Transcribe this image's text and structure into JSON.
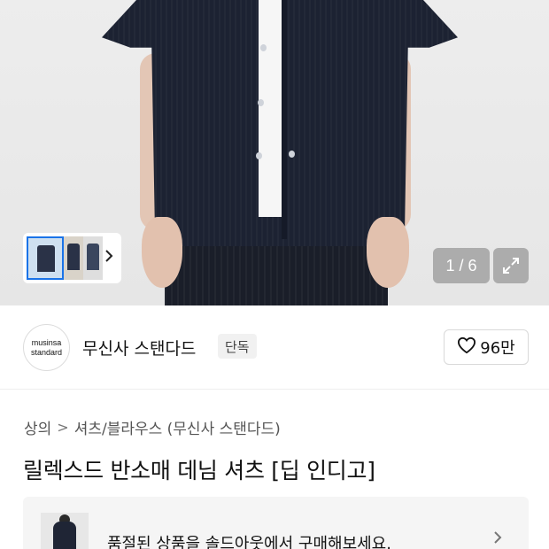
{
  "gallery": {
    "counter": "1 / 6",
    "thumb_icon": "chevron-right-icon",
    "expand_icon": "expand-icon"
  },
  "brand": {
    "logo_line1": "musinsa",
    "logo_line2": "standard",
    "name": "무신사 스탠다드",
    "tag": "단독",
    "like_icon": "heart-icon",
    "like_count": "96만"
  },
  "breadcrumb": {
    "level1": "상의",
    "separator": ">",
    "level2": "셔츠/블라우스 (무신사 스탠다드)"
  },
  "product": {
    "title": "릴렉스드 반소매 데님 셔츠 [딥 인디고]"
  },
  "notice": {
    "text": "품절된 상품을 솔드아웃에서 구매해보세요.",
    "arrow": "›"
  },
  "colors": {
    "shirt": "#1c2232",
    "selected_thumb_border": "#1a73e8"
  }
}
